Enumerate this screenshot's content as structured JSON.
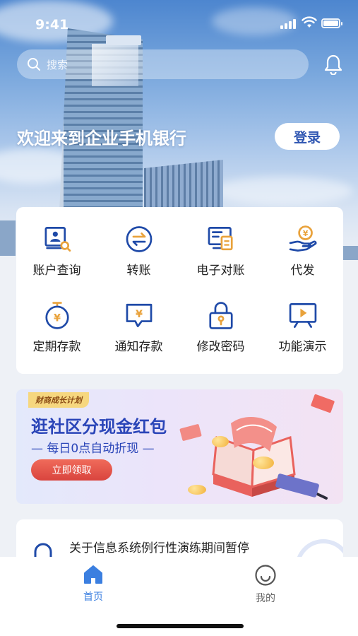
{
  "status_bar": {
    "time": "9:41"
  },
  "search": {
    "placeholder": "搜索"
  },
  "hero": {
    "welcome": "欢迎来到企业手机银行",
    "login_label": "登录"
  },
  "grid": [
    {
      "label": "账户查询",
      "icon": "account-query-icon"
    },
    {
      "label": "转账",
      "icon": "transfer-icon"
    },
    {
      "label": "电子对账",
      "icon": "e-reconciliation-icon"
    },
    {
      "label": "代发",
      "icon": "payroll-icon"
    },
    {
      "label": "定期存款",
      "icon": "fixed-deposit-icon"
    },
    {
      "label": "通知存款",
      "icon": "notice-deposit-icon"
    },
    {
      "label": "修改密码",
      "icon": "lock-icon"
    },
    {
      "label": "功能演示",
      "icon": "demo-play-icon"
    }
  ],
  "banner": {
    "tag": "财商成长计划",
    "title": "逛社区分现金红包",
    "subtitle": "— 每日0点自动折现 —",
    "button": "立即领取"
  },
  "notice": {
    "text": "关于信息系统例行性演练期间暂停"
  },
  "tabs": [
    {
      "label": "首页",
      "icon": "home-icon",
      "active": true
    },
    {
      "label": "我的",
      "icon": "smiley-icon",
      "active": false
    }
  ],
  "colors": {
    "accent": "#2f56b2",
    "icon_blue": "#1f4aa8",
    "icon_orange": "#e9a23b",
    "tab_active": "#3b7fe0",
    "tab_inactive": "#666666"
  }
}
